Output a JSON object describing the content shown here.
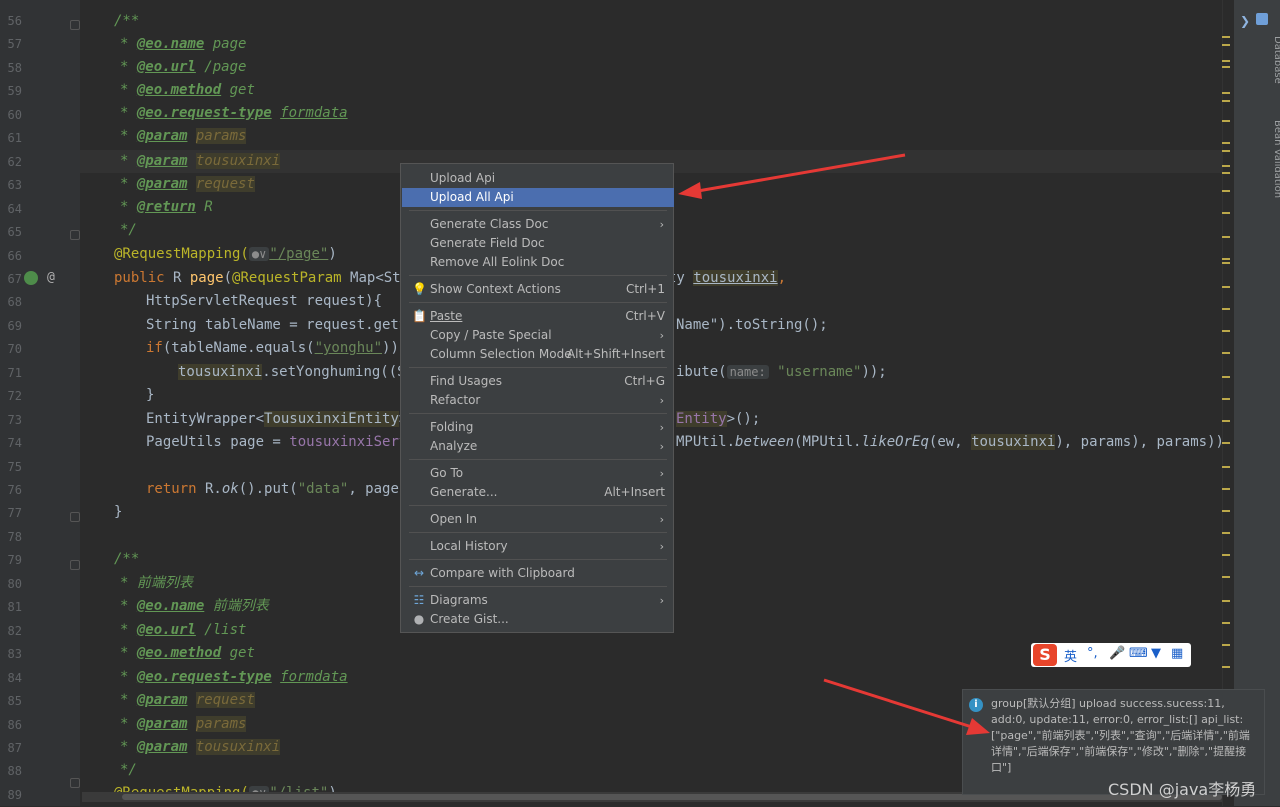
{
  "editor": {
    "line_numbers": [
      "56",
      "57",
      "58",
      "59",
      "60",
      "61",
      "62",
      "63",
      "64",
      "65",
      "66",
      "67",
      "68",
      "69",
      "70",
      "71",
      "72",
      "73",
      "74",
      "75",
      "76",
      "77",
      "78",
      "79",
      "80",
      "81",
      "82",
      "83",
      "84",
      "85",
      "86",
      "87",
      "88",
      "89"
    ],
    "lines": {
      "l56": "/**",
      "l57_tag": "@eo.name",
      "l57_val": " page",
      "l58_tag": "@eo.url",
      "l58_val": " /page",
      "l59_tag": "@eo.method",
      "l59_val": " get",
      "l60_tag": "@eo.request-type",
      "l60_val": "formdata",
      "l61_tag": "@param",
      "l61_val": "params",
      "l62_tag": "@param",
      "l62_val": "tousuxinxi",
      "l63_tag": "@param",
      "l63_val": "request",
      "l64_tag": "@return",
      "l64_val": " R",
      "l65": "*/",
      "l66_ann": "@RequestMapping(",
      "l66_hint": "●∨",
      "l66_str": "\"/page\"",
      "l66_end": ")",
      "l67_a": "public",
      "l67_b": " R ",
      "l67_c": "page",
      "l67_d": "(",
      "l67_e": "@RequestParam",
      "l67_f": " Map<Str",
      "l67_g": "ty ",
      "l67_h": "tousuxinxi",
      "l67_i": ",",
      "l68": "HttpServletRequest request){",
      "l69_a": "String tableName = request.getS",
      "l69_b": "Name\").toString();",
      "l70_a": "if",
      "l70_b": "(tableName.equals(",
      "l70_c": "\"yonghu\"",
      "l70_d": ")) ",
      "l71_a": "tousuxinxi",
      "l71_b": ".setYonghuming((St",
      "l71_c": "ibute(",
      "l71_hint": "name:",
      "l71_str": "\"username\"",
      "l71_d": "));",
      "l72": "}",
      "l73_a": "EntityWrapper<",
      "l73_b": "TousuxinxiEntity",
      "l73_c": ">",
      "l73_d": "Entity",
      "l73_e": ">();",
      "l74_a": "PageUtils page = ",
      "l74_b": "tousuxinxiServ",
      "l74_c": "MPUtil.",
      "l74_d": "between",
      "l74_e": "(MPUtil.",
      "l74_f": "likeOrEq",
      "l74_g": "(ew, ",
      "l74_h": "tousuxinxi",
      "l74_i": "), params), params));",
      "l76_a": "return",
      "l76_b": " R.",
      "l76_c": "ok",
      "l76_d": "().put(",
      "l76_e": "\"data\"",
      "l76_f": ", page)",
      "l77": "}",
      "l79": "/**",
      "l80": "前端列表",
      "l81_tag": "@eo.name",
      "l81_val": "前端列表",
      "l82_tag": "@eo.url",
      "l82_val": " /list",
      "l83_tag": "@eo.method",
      "l83_val": " get",
      "l84_tag": "@eo.request-type",
      "l84_val": "formdata",
      "l85_tag": "@param",
      "l85_val": "request",
      "l86_tag": "@param",
      "l86_val": "params",
      "l87_tag": "@param",
      "l87_val": "tousuxinxi",
      "l88": "*/",
      "l89_ann": "@RequestMapping(",
      "l89_hint": "●∨",
      "l89_str": "\"/list\"",
      "l89_end": ")"
    }
  },
  "context_menu": {
    "upload_api": "Upload Api",
    "upload_all_api": "Upload All Api",
    "generate_class_doc": "Generate Class Doc",
    "generate_field_doc": "Generate Field Doc",
    "remove_all_eolink_doc": "Remove All Eolink Doc",
    "show_context_actions": "Show Context Actions",
    "show_context_actions_sc": "Ctrl+1",
    "paste": "Paste",
    "paste_sc": "Ctrl+V",
    "copy_paste_special": "Copy / Paste Special",
    "column_selection_mode": "Column Selection Mode",
    "column_selection_mode_sc": "Alt+Shift+Insert",
    "find_usages": "Find Usages",
    "find_usages_sc": "Ctrl+G",
    "refactor": "Refactor",
    "folding": "Folding",
    "analyze": "Analyze",
    "go_to": "Go To",
    "generate": "Generate...",
    "generate_sc": "Alt+Insert",
    "open_in": "Open In",
    "local_history": "Local History",
    "compare_with_clipboard": "Compare with Clipboard",
    "diagrams": "Diagrams",
    "create_gist": "Create Gist...",
    "submenu_arrow": "›"
  },
  "notification": {
    "info_icon": "i",
    "text": "group[默认分组] upload success.sucess:11, add:0, update:11, error:0, error_list:[] api_list:[\"page\",\"前端列表\",\"列表\",\"查询\",\"后端详情\",\"前端详情\",\"后端保存\",\"前端保存\",\"修改\",\"删除\",\"提醒接口\"]"
  },
  "ime_toolbar": {
    "logo": "S",
    "mode": "英",
    "punct": "°,"
  },
  "right_panel": {
    "database_label": "Database",
    "bean_validation_label": "Bean Validation"
  },
  "watermark": "CSDN @java李杨勇",
  "gutter_at": "@",
  "colors": {
    "editor_bg": "#2b2b2b",
    "menu_bg": "#3c3f41",
    "menu_selected": "#4b6eaf",
    "comment": "#629755",
    "keyword": "#cc7832",
    "string": "#6a8759",
    "annotation": "#bbb529",
    "arrow": "#e53935"
  }
}
